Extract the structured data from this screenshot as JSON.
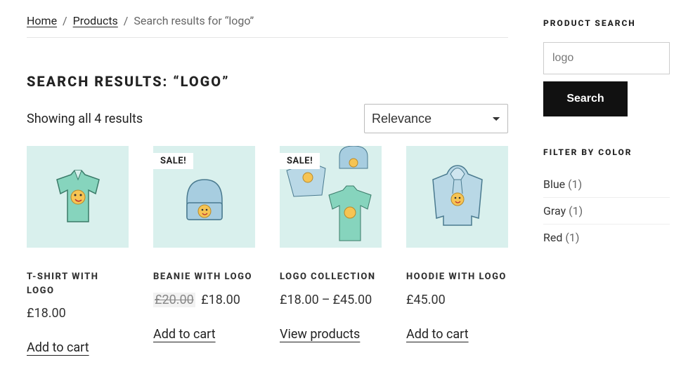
{
  "breadcrumb": {
    "home": "Home",
    "products": "Products",
    "tail": "Search results for “logo”"
  },
  "title_prefix": "SEARCH RESULTS:",
  "title_query": "“LOGO”",
  "result_count": "Showing all 4 results",
  "sort_selected": "Relevance",
  "products": [
    {
      "name": "T-SHIRT WITH LOGO",
      "price": "£18.00",
      "action": "Add to cart",
      "sale": false
    },
    {
      "name": "BEANIE WITH LOGO",
      "old_price": "£20.00",
      "price": "£18.00",
      "action": "Add to cart",
      "sale": true
    },
    {
      "name": "LOGO COLLECTION",
      "price_from": "£18.00",
      "price_to": "£45.00",
      "action": "View products",
      "sale": true
    },
    {
      "name": "HOODIE WITH LOGO",
      "price": "£45.00",
      "action": "Add to cart",
      "sale": false
    }
  ],
  "sale_label": "SALE!",
  "sidebar": {
    "search_title": "PRODUCT SEARCH",
    "search_value": "logo",
    "search_button": "Search",
    "filter_title": "FILTER BY COLOR",
    "colors": [
      {
        "name": "Blue",
        "count": "(1)"
      },
      {
        "name": "Gray",
        "count": "(1)"
      },
      {
        "name": "Red",
        "count": "(1)"
      }
    ]
  }
}
